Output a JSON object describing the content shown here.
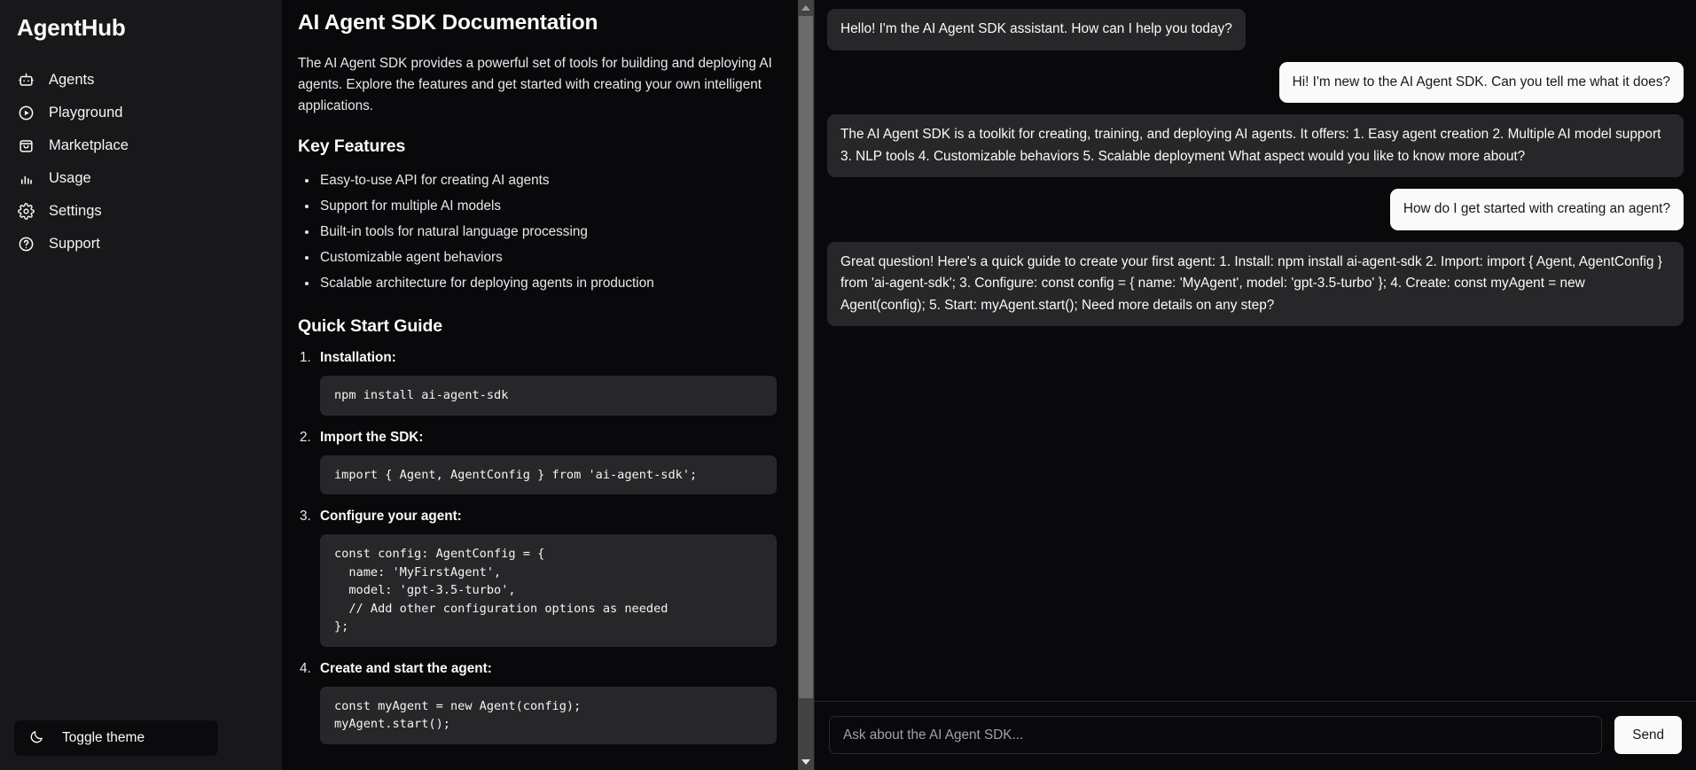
{
  "sidebar": {
    "brand": "AgentHub",
    "items": [
      {
        "label": "Agents",
        "icon": "bot-icon"
      },
      {
        "label": "Playground",
        "icon": "play-circle-icon"
      },
      {
        "label": "Marketplace",
        "icon": "shopping-bag-icon"
      },
      {
        "label": "Usage",
        "icon": "bar-chart-icon"
      },
      {
        "label": "Settings",
        "icon": "gear-icon"
      },
      {
        "label": "Support",
        "icon": "help-circle-icon"
      }
    ],
    "toggle_theme": {
      "label": "Toggle theme",
      "icon": "moon-icon"
    }
  },
  "docs": {
    "title": "AI Agent SDK Documentation",
    "intro": "The AI Agent SDK provides a powerful set of tools for building and deploying AI agents. Explore the features and get started with creating your own intelligent applications.",
    "features_heading": "Key Features",
    "features": [
      "Easy-to-use API for creating AI agents",
      "Support for multiple AI models",
      "Built-in tools for natural language processing",
      "Customizable agent behaviors",
      "Scalable architecture for deploying agents in production"
    ],
    "quickstart_heading": "Quick Start Guide",
    "steps": [
      {
        "title": "Installation:",
        "code": "npm install ai-agent-sdk"
      },
      {
        "title": "Import the SDK:",
        "code": "import { Agent, AgentConfig } from 'ai-agent-sdk';"
      },
      {
        "title": "Configure your agent:",
        "code": "const config: AgentConfig = {\n  name: 'MyFirstAgent',\n  model: 'gpt-3.5-turbo',\n  // Add other configuration options as needed\n};"
      },
      {
        "title": "Create and start the agent:",
        "code": "const myAgent = new Agent(config);\nmyAgent.start();"
      }
    ]
  },
  "scrollbar": {
    "up_arrow_icon": "caret-up-icon",
    "down_arrow_icon": "caret-down-icon"
  },
  "chat": {
    "messages": [
      {
        "role": "assistant",
        "text": "Hello! I'm the AI Agent SDK assistant. How can I help you today?"
      },
      {
        "role": "user",
        "text": "Hi! I'm new to the AI Agent SDK. Can you tell me what it does?"
      },
      {
        "role": "assistant",
        "text": "The AI Agent SDK is a toolkit for creating, training, and deploying AI agents. It offers: 1. Easy agent creation 2. Multiple AI model support 3. NLP tools 4. Customizable behaviors 5. Scalable deployment What aspect would you like to know more about?"
      },
      {
        "role": "user",
        "text": "How do I get started with creating an agent?"
      },
      {
        "role": "assistant",
        "text": "Great question! Here's a quick guide to create your first agent: 1. Install: npm install ai-agent-sdk 2. Import: import { Agent, AgentConfig } from 'ai-agent-sdk'; 3. Configure: const config = { name: 'MyAgent', model: 'gpt-3.5-turbo' }; 4. Create: const myAgent = new Agent(config); 5. Start: myAgent.start(); Need more details on any step?"
      }
    ],
    "input": {
      "value": "",
      "placeholder": "Ask about the AI Agent SDK..."
    },
    "send_label": "Send"
  },
  "colors": {
    "sidebar_bg": "#18181b",
    "page_bg": "#09090b",
    "code_bg": "#27272a",
    "assistant_bubble": "#27272a",
    "user_bubble": "#fafafa",
    "accent_text": "#fafafa",
    "scrollbar_track": "#434343",
    "scrollbar_thumb": "#6b6b6b"
  }
}
